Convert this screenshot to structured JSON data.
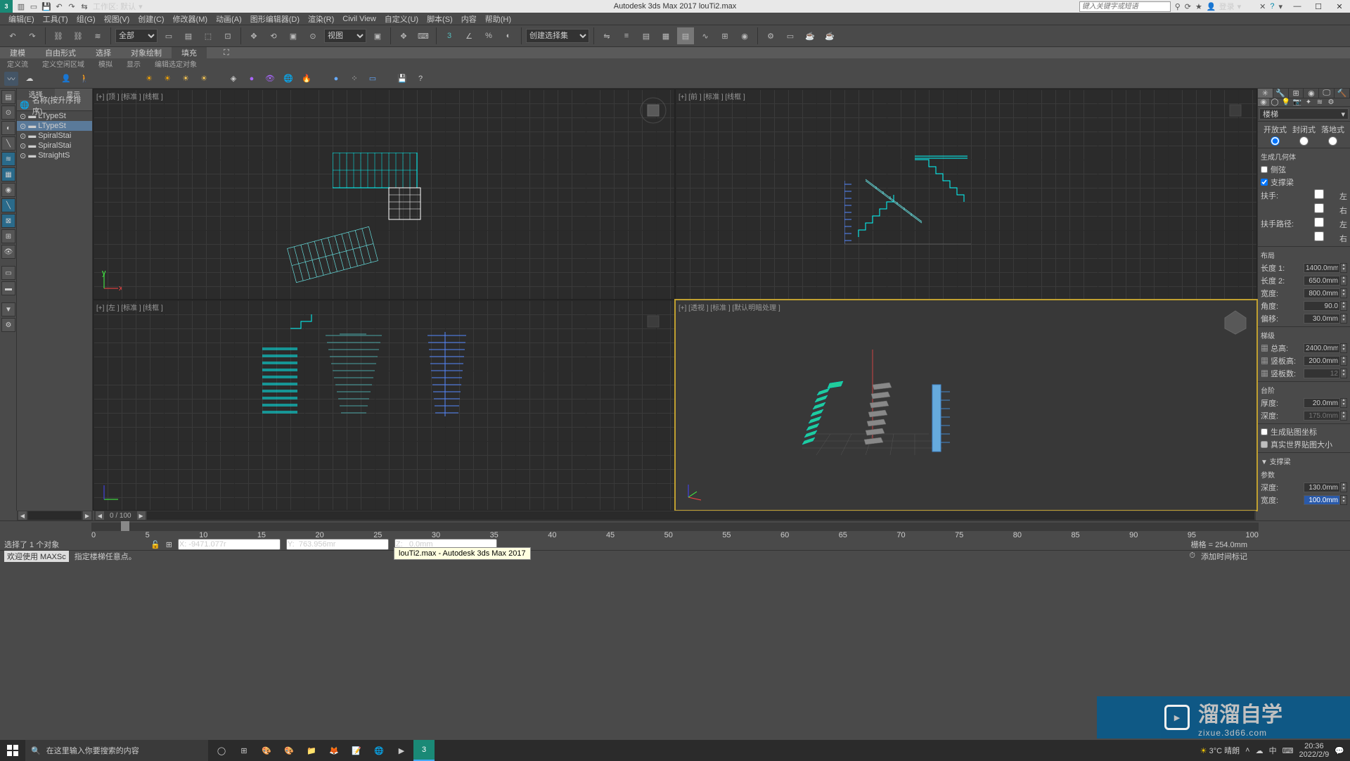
{
  "titlebar": {
    "workspace_label": "工作区: 默认",
    "app_title": "Autodesk 3ds Max 2017    louTi2.max",
    "search_placeholder": "键入关键字或短语",
    "login_label": "登录"
  },
  "menubar": [
    "编辑(E)",
    "工具(T)",
    "组(G)",
    "视图(V)",
    "创建(C)",
    "修改器(M)",
    "动画(A)",
    "图形编辑器(D)",
    "渲染(R)",
    "Civil View",
    "自定义(U)",
    "脚本(S)",
    "内容",
    "帮助(H)"
  ],
  "toolbar": {
    "filter_label": "全部",
    "view_label": "视图",
    "selset_label": "创建选择集"
  },
  "ribbon_tabs": [
    "建模",
    "自由形式",
    "选择",
    "对象绘制",
    "填充"
  ],
  "subribbon": [
    "定义流",
    "定义空闲区域",
    "模拟",
    "显示",
    "编辑选定对象"
  ],
  "scene_explorer": {
    "tabs": [
      "选择",
      "显示"
    ],
    "header": "名称(按升序排序)",
    "items": [
      {
        "name": "LTypeSt",
        "sel": false
      },
      {
        "name": "LTypeSt",
        "sel": true
      },
      {
        "name": "SpiralStai",
        "sel": false
      },
      {
        "name": "SpiralStai",
        "sel": false
      },
      {
        "name": "StraightS",
        "sel": false
      }
    ]
  },
  "viewports": {
    "top": "[+] [顶 ] [标准 ] [线框 ]",
    "front": "[+] [前 ] [标准 ] [线框 ]",
    "left": "[+] [左 ] [标准 ] [线框 ]",
    "persp": "[+] [透视 ] [标准 ] [默认明暗处理 ]"
  },
  "command_panel": {
    "category": "楼梯",
    "types": [
      "开放式",
      "封闭式",
      "落地式"
    ],
    "rollout_geom": "生成几何体",
    "chk_stringer": "侧弦",
    "chk_carriage": "支撑梁",
    "handrails_label": "扶手:",
    "railpath_label": "扶手路径:",
    "left": "左",
    "right": "右",
    "rollout_layout": "布局",
    "params": {
      "length1": {
        "label": "长度 1:",
        "value": "1400.0mm"
      },
      "length2": {
        "label": "长度 2:",
        "value": "650.0mm"
      },
      "width": {
        "label": "宽度:",
        "value": "800.0mm"
      },
      "angle": {
        "label": "角度:",
        "value": "90.0"
      },
      "offset": {
        "label": "偏移:",
        "value": "30.0mm"
      }
    },
    "rollout_steps": "梯级",
    "steps": {
      "overall": {
        "label": "总高:",
        "value": "2400.0mm"
      },
      "riser": {
        "label": "竖板高:",
        "value": "200.0mm"
      },
      "count": {
        "label": "竖板数:",
        "value": "12"
      }
    },
    "rollout_step": "台阶",
    "step": {
      "thick": {
        "label": "厚度:",
        "value": "20.0mm"
      },
      "depth": {
        "label": "深度:",
        "value": "175.0mm"
      }
    },
    "chk_genmap": "生成贴图坐标",
    "chk_realworld": "真实世界贴图大小",
    "rollout_carriage_header": "▼ 支撑梁",
    "carriage_params_label": "参数",
    "carriage": {
      "depth": {
        "label": "深度:",
        "value": "130.0mm"
      },
      "width": {
        "label": "宽度:",
        "value": "100.0mm"
      }
    }
  },
  "timeline": {
    "page": "0 / 100",
    "ticks": [
      "0",
      "5",
      "10",
      "15",
      "20",
      "25",
      "30",
      "35",
      "40",
      "45",
      "50",
      "55",
      "60",
      "65",
      "70",
      "75",
      "80",
      "85",
      "90",
      "95",
      "100"
    ]
  },
  "statusbar": {
    "selection": "选择了 1 个对象",
    "welcome": "欢迎使用 MAXSc",
    "prompt": "指定楼梯任意点。",
    "coords": {
      "x": "X: -9471.077r",
      "y": "Y:  763.956mr",
      "z": "Z:   0.0mm"
    },
    "grid": "栅格 = 254.0mm",
    "addtime": "添加时间标记"
  },
  "tooltip": "louTi2.max - Autodesk 3ds Max 2017",
  "watermark": {
    "text": "溜溜自学",
    "url": "zixue.3d66.com"
  },
  "taskbar": {
    "search_placeholder": "在这里输入你要搜索的内容",
    "weather": "3°C 晴朗",
    "time": "20:36",
    "date": "2022/2/9",
    "ime": "中"
  }
}
